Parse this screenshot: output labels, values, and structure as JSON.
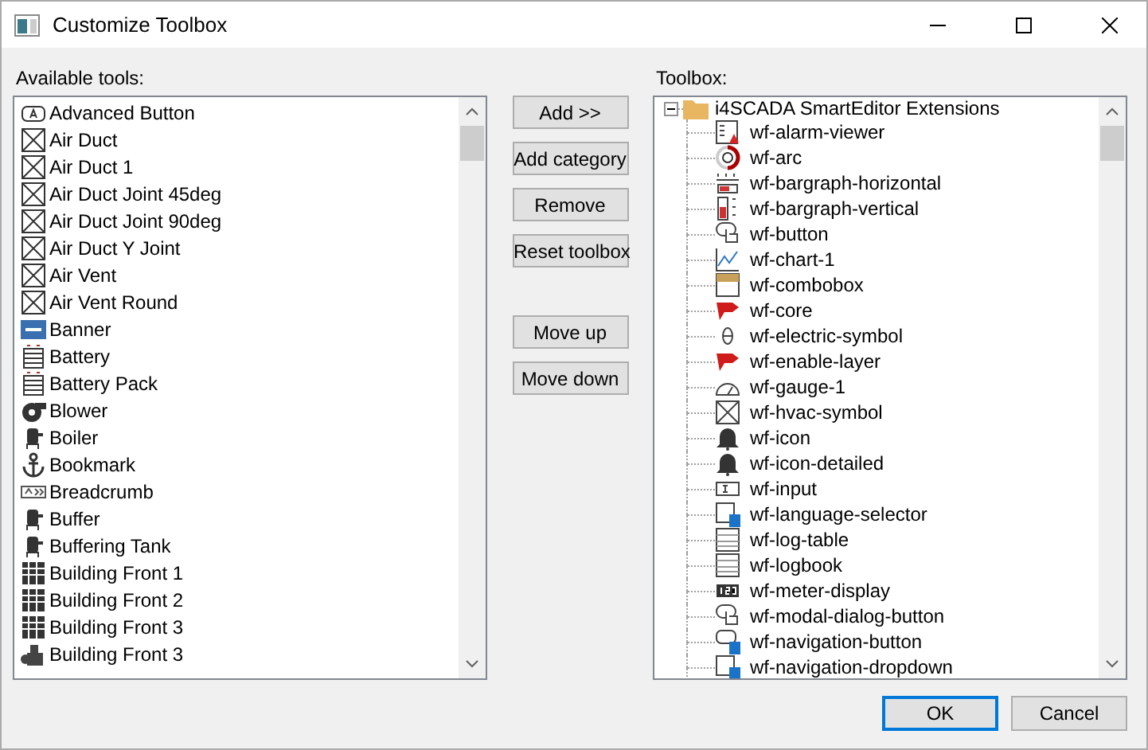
{
  "window": {
    "title": "Customize Toolbox"
  },
  "available": {
    "label": "Available tools:",
    "items": [
      {
        "label": "Advanced Button"
      },
      {
        "label": "Air Duct"
      },
      {
        "label": "Air Duct 1"
      },
      {
        "label": "Air Duct Joint 45deg"
      },
      {
        "label": "Air Duct Joint 90deg"
      },
      {
        "label": "Air Duct Y Joint"
      },
      {
        "label": "Air Vent"
      },
      {
        "label": "Air Vent Round"
      },
      {
        "label": "Banner"
      },
      {
        "label": "Battery"
      },
      {
        "label": "Battery Pack"
      },
      {
        "label": "Blower"
      },
      {
        "label": "Boiler"
      },
      {
        "label": "Bookmark"
      },
      {
        "label": "Breadcrumb"
      },
      {
        "label": "Buffer"
      },
      {
        "label": "Buffering Tank"
      },
      {
        "label": "Building Front 1"
      },
      {
        "label": "Building Front 2"
      },
      {
        "label": "Building Front 3"
      },
      {
        "label": "Building Front 3"
      }
    ]
  },
  "actions": [
    {
      "label": "Add >>"
    },
    {
      "label": "Add category"
    },
    {
      "label": "Remove"
    },
    {
      "label": "Reset toolbox"
    },
    {
      "label": "Move up"
    },
    {
      "label": "Move down"
    }
  ],
  "toolbox": {
    "label": "Toolbox:",
    "root": {
      "label": "i4SCADA SmartEditor Extensions",
      "expanded": true,
      "children": [
        {
          "label": "wf-alarm-viewer"
        },
        {
          "label": "wf-arc"
        },
        {
          "label": "wf-bargraph-horizontal"
        },
        {
          "label": "wf-bargraph-vertical"
        },
        {
          "label": "wf-button"
        },
        {
          "label": "wf-chart-1"
        },
        {
          "label": "wf-combobox"
        },
        {
          "label": "wf-core"
        },
        {
          "label": "wf-electric-symbol"
        },
        {
          "label": "wf-enable-layer"
        },
        {
          "label": "wf-gauge-1"
        },
        {
          "label": "wf-hvac-symbol"
        },
        {
          "label": "wf-icon"
        },
        {
          "label": "wf-icon-detailed"
        },
        {
          "label": "wf-input"
        },
        {
          "label": "wf-language-selector"
        },
        {
          "label": "wf-log-table"
        },
        {
          "label": "wf-logbook"
        },
        {
          "label": "wf-meter-display"
        },
        {
          "label": "wf-modal-dialog-button"
        },
        {
          "label": "wf-navigation-button"
        },
        {
          "label": "wf-navigation-dropdown"
        }
      ]
    }
  },
  "buttons": [
    {
      "label": "OK",
      "default": true
    },
    {
      "label": "Cancel",
      "default": false
    }
  ]
}
